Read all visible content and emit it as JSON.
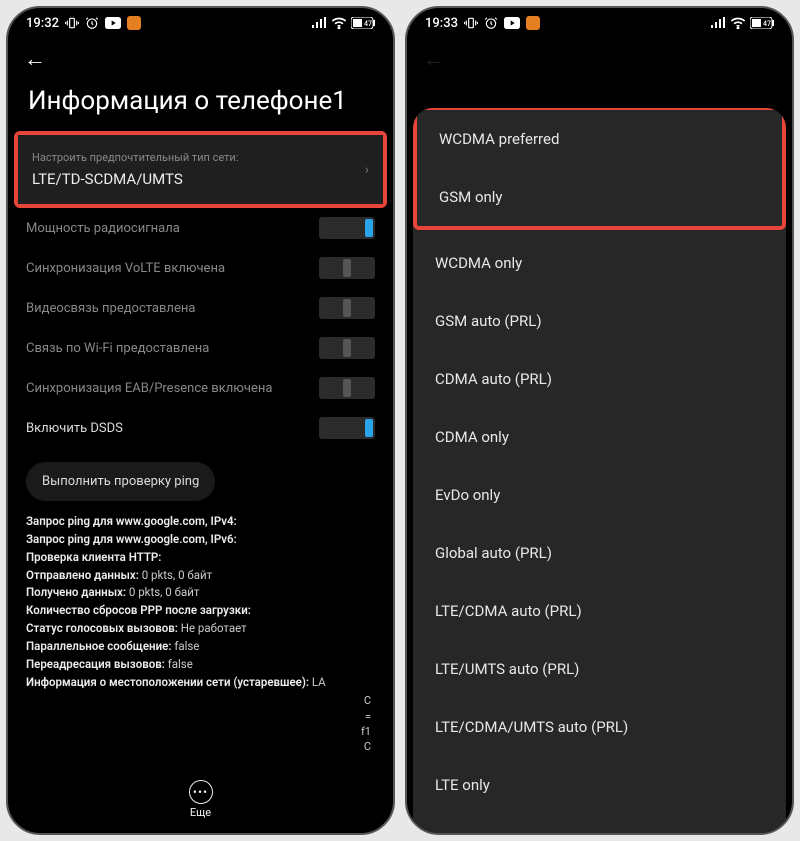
{
  "left": {
    "status": {
      "time": "19:32",
      "battery": "47"
    },
    "title": "Информация о телефоне1",
    "pref_sub": "Настроить предпочтительный тип сети:",
    "pref_value": "LTE/TD-SCDMA/UMTS",
    "rows": [
      {
        "label": "Мощность радиосигнала",
        "state": "on"
      },
      {
        "label": "Синхронизация VoLTE включена",
        "state": "mid"
      },
      {
        "label": "Видеосвязь предоставлена",
        "state": "mid"
      },
      {
        "label": "Связь по Wi-Fi предоставлена",
        "state": "mid"
      },
      {
        "label": "Синхронизация EAB/Presence включена",
        "state": "mid"
      },
      {
        "label": "Включить DSDS",
        "state": "on",
        "active": true
      }
    ],
    "ping_btn": "Выполнить проверку ping",
    "info": {
      "l1": "Запрос ping для www.google.com, IPv4:",
      "l2": "Запрос ping для www.google.com, IPv6:",
      "l3": "Проверка клиента HTTP:",
      "l4b": "Отправлено данных:",
      "l4v": " 0 pkts, 0 байт",
      "l5b": "Получено данных:",
      "l5v": " 0 pkts, 0 байт",
      "l6": "Количество сбросов PPP после загрузки:",
      "l7b": "Статус голосовых вызовов:",
      "l7v": " Не работает",
      "l8b": "Параллельное сообщение:",
      "l8v": " false",
      "l9b": "Переадресация вызовов:",
      "l9v": " false",
      "l10b": "Информация о местоположении сети (устаревшее):",
      "l10v": " LA"
    },
    "trail": [
      "C",
      "=",
      "f1",
      "C"
    ],
    "more": "Еще"
  },
  "right": {
    "status": {
      "time": "19:33",
      "battery": "47"
    },
    "highlight": [
      "WCDMA preferred",
      "GSM only"
    ],
    "options": [
      "WCDMA only",
      "GSM auto (PRL)",
      "CDMA auto (PRL)",
      "CDMA only",
      "EvDo only",
      "Global auto (PRL)",
      "LTE/CDMA auto (PRL)",
      "LTE/UMTS auto (PRL)",
      "LTE/CDMA/UMTS auto (PRL)",
      "LTE only"
    ]
  }
}
